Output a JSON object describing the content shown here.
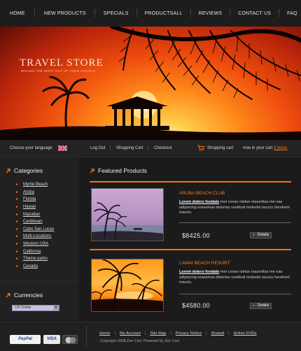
{
  "nav": {
    "items": [
      "HOME",
      "NEW PRODUCTS",
      "SPECIALS",
      "PRODUCTSALL",
      "REVIEWS",
      "CONTACT US",
      "FAQ"
    ]
  },
  "banner": {
    "title": "TRAVEL STORE",
    "tagline": "MAKING THE MOST OUT OF YOUR HOLIDAY"
  },
  "strip": {
    "language_label": "Choose your language:",
    "language_flag": "uk-flag-icon",
    "links": [
      "Log Out",
      "Shopping Cart",
      "Checkout"
    ],
    "cart_label": "Shopping cart:",
    "cart_status_prefix": "now in your cart",
    "cart_items": "3 items"
  },
  "sidebar": {
    "categories_title": "Categories",
    "categories": [
      "Myrtle Beach",
      "Aruba",
      "Florida",
      "Hawaii",
      "Mazatlan",
      "Caribbean",
      "Cabo San Lucas",
      "Multi-Locations",
      "Western USA",
      "California",
      "Theme parks",
      "Canada"
    ],
    "currencies_title": "Currencies",
    "currency_selected": "US Dollar"
  },
  "main": {
    "featured_title": "Featured Products",
    "products": [
      {
        "name": "ARUBA BEACH CLUB",
        "desc_lead": "Lorem dolero fondale",
        "desc_rest": " met conse ctetue maserttas me nas adipiscing erasemas delortas vestibuil molestie lacuny hendrerit mauris.",
        "price": "$8425.00",
        "details": "Details"
      },
      {
        "name": "LAWAI BEACH RESORT",
        "desc_lead": "Lorem dolero fondale",
        "desc_rest": " met conse ctetue maserttas me nas adipiscing erasemas delortas vestibuil molestie lacuny hendrerit mauris.",
        "price": "$4580.00",
        "details": "Details"
      }
    ]
  },
  "footer": {
    "payments": [
      "PayPal",
      "VISA",
      "MasterCard"
    ],
    "links": [
      "Home",
      "My Account",
      "Site Map",
      "Privacy Notice",
      "Shared",
      "Action DVDs"
    ],
    "copyright": "Copyright 2008 Zen Cart. Powered by Zen Cart"
  },
  "colors": {
    "accent": "#ff6a14",
    "background": "#1b1b1b"
  }
}
